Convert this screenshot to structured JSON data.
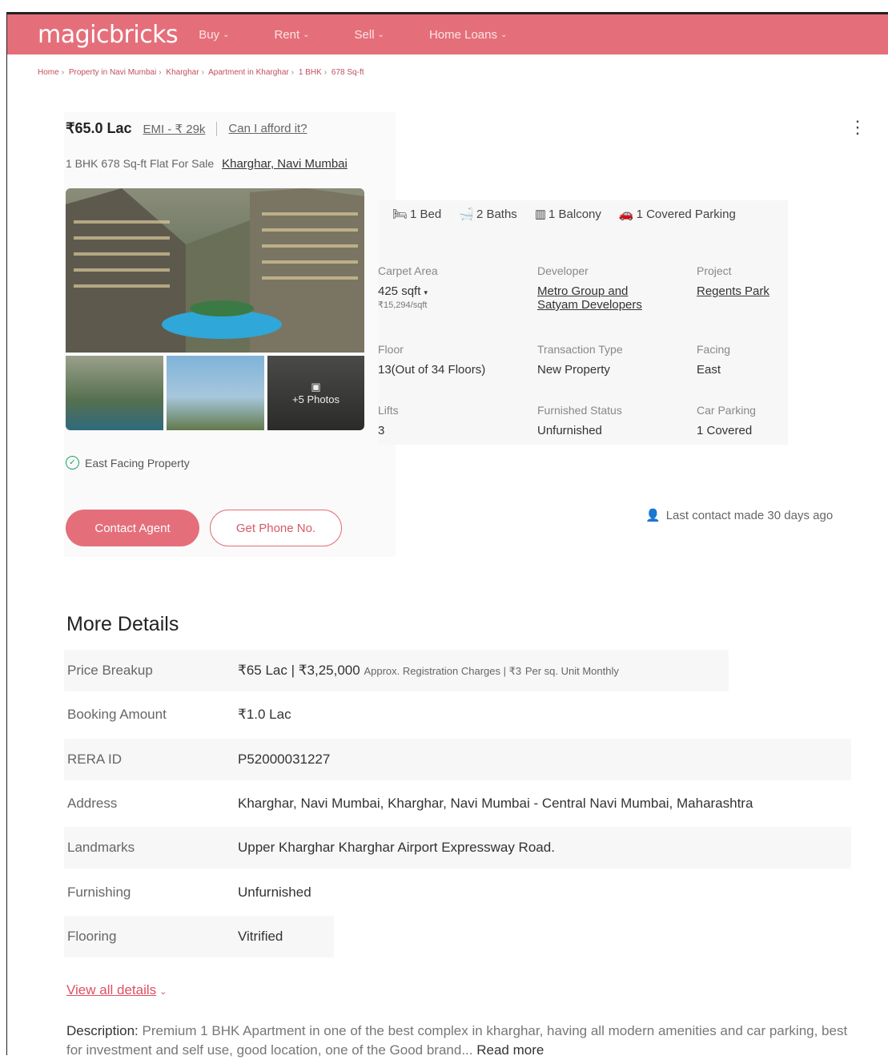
{
  "header": {
    "logo": "magicbricks",
    "nav": [
      {
        "label": "Buy"
      },
      {
        "label": "Rent"
      },
      {
        "label": "Sell"
      },
      {
        "label": "Home Loans"
      }
    ]
  },
  "breadcrumb": [
    "Home",
    "Property in Navi Mumbai",
    "Kharghar",
    "Apartment in Kharghar",
    "1 BHK",
    "678 Sq-ft"
  ],
  "listing": {
    "price": "₹65.0 Lac",
    "emi": "EMI - ₹ 29k",
    "afford": "Can I afford it?",
    "title_prefix": "1 BHK 678 Sq-ft Flat For Sale",
    "location": "Kharghar, Navi Mumbai",
    "photos_more": "+5 Photos"
  },
  "amenities": [
    {
      "icon": "bed-icon",
      "label": "1 Bed"
    },
    {
      "icon": "bath-icon",
      "label": "2 Baths"
    },
    {
      "icon": "balcony-icon",
      "label": "1 Balcony"
    },
    {
      "icon": "parking-icon",
      "label": "1 Covered Parking"
    }
  ],
  "specs": {
    "carpet_area": {
      "label": "Carpet Area",
      "value": "425 sqft",
      "sub": "₹15,294/sqft"
    },
    "developer": {
      "label": "Developer",
      "value_line1": "Metro Group and",
      "value_line2": "Satyam Developers"
    },
    "project": {
      "label": "Project",
      "value": "Regents Park"
    },
    "floor": {
      "label": "Floor",
      "value": "13(Out of 34 Floors)"
    },
    "transaction": {
      "label": "Transaction Type",
      "value": "New Property"
    },
    "facing": {
      "label": "Facing",
      "value": "East"
    },
    "lifts": {
      "label": "Lifts",
      "value": "3"
    },
    "furnished": {
      "label": "Furnished Status",
      "value": "Unfurnished"
    },
    "car_parking": {
      "label": "Car Parking",
      "value": "1 Covered"
    }
  },
  "highlight": "East Facing Property",
  "buttons": {
    "contact": "Contact Agent",
    "phone": "Get Phone No."
  },
  "last_contact": "Last contact made 30 days ago",
  "more_details": {
    "title": "More Details",
    "rows": [
      {
        "key": "Price Breakup",
        "value": "₹65 Lac | ₹3,25,000",
        "extra": "Approx. Registration Charges | ₹3",
        "extra2": "Per sq. Unit Monthly"
      },
      {
        "key": "Booking Amount",
        "value": "₹1.0 Lac"
      },
      {
        "key": "RERA ID",
        "value": "P52000031227"
      },
      {
        "key": "Address",
        "value": "Kharghar, Navi Mumbai, Kharghar, Navi Mumbai - Central Navi Mumbai, Maharashtra"
      },
      {
        "key": "Landmarks",
        "value": "Upper Kharghar Kharghar Airport Expressway Road."
      },
      {
        "key": "Furnishing",
        "value": "Unfurnished"
      },
      {
        "key": "Flooring",
        "value": "Vitrified"
      }
    ],
    "view_all": "View all details"
  },
  "description": {
    "label": "Description:",
    "text": "Premium 1 BHK Apartment in one of the best complex in kharghar, having all modern amenities and car parking, best for investment and self use, good location, one of the Good brand...",
    "read_more": "Read more"
  },
  "colors": {
    "brand": "#e46f7a",
    "link_red": "#e05060",
    "success": "#1ea36a"
  }
}
